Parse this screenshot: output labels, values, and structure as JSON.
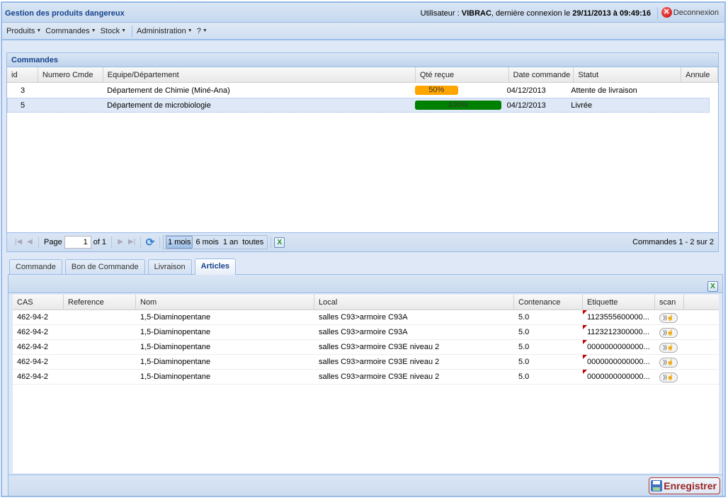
{
  "app": {
    "title": "Gestion des produits dangereux",
    "user_prefix": "Utilisateur : ",
    "user_name": "VIBRAC",
    "last_login_prefix": ", dernière connexion le ",
    "last_login": "29/11/2013 à 09:49:16",
    "logout_label": "Deconnexion"
  },
  "menu": [
    {
      "label": "Produits"
    },
    {
      "label": "Commandes"
    },
    {
      "label": "Stock"
    },
    {
      "label": "Administration"
    },
    {
      "label": "?"
    }
  ],
  "commandes": {
    "title": "Commandes",
    "columns": [
      "id",
      "Numero Cmde",
      "Equipe/Département",
      "Qté reçue",
      "Date commande",
      "Statut",
      "Annule"
    ],
    "rows": [
      {
        "id": "3",
        "numero": "",
        "equipe": "Département de Chimie (Miné-Ana)",
        "qte_label": "50%",
        "qte_fraction": 0.5,
        "qte_color": "#ffa500",
        "date": "04/12/2013",
        "statut": "Attente de livraison",
        "annule": "",
        "selected": false
      },
      {
        "id": "5",
        "numero": "",
        "equipe": "Département de microbiologie",
        "qte_label": "100%",
        "qte_fraction": 1.0,
        "qte_color": "#008000",
        "date": "04/12/2013",
        "statut": "Livrée",
        "annule": "",
        "selected": true
      }
    ],
    "pager": {
      "page_label": "Page",
      "page_value": "1",
      "of_label": "of 1",
      "ranges": [
        {
          "label": "1 mois",
          "active": true
        },
        {
          "label": "6 mois",
          "active": false
        },
        {
          "label": "1 an",
          "active": false
        },
        {
          "label": "toutes",
          "active": false
        }
      ],
      "info": "Commandes 1 - 2 sur 2"
    }
  },
  "tabs": [
    {
      "label": "Commande",
      "active": false
    },
    {
      "label": "Bon de Commande",
      "active": false
    },
    {
      "label": "Livraison",
      "active": false
    },
    {
      "label": "Articles",
      "active": true
    }
  ],
  "articles": {
    "columns": [
      "CAS",
      "Reference",
      "Nom",
      "Local",
      "Contenance",
      "Etiquette",
      "scan"
    ],
    "rows": [
      {
        "cas": "462-94-2",
        "reference": "",
        "nom": "1,5-Diaminopentane",
        "local": "salles C93>armoire C93A",
        "contenance": "5.0",
        "etiquette": "1123555600000..."
      },
      {
        "cas": "462-94-2",
        "reference": "",
        "nom": "1,5-Diaminopentane",
        "local": "salles C93>armoire C93A",
        "contenance": "5.0",
        "etiquette": "1123212300000..."
      },
      {
        "cas": "462-94-2",
        "reference": "",
        "nom": "1,5-Diaminopentane",
        "local": "salles C93>armoire C93E niveau 2",
        "contenance": "5.0",
        "etiquette": "0000000000000..."
      },
      {
        "cas": "462-94-2",
        "reference": "",
        "nom": "1,5-Diaminopentane",
        "local": "salles C93>armoire C93E niveau 2",
        "contenance": "5.0",
        "etiquette": "0000000000000..."
      },
      {
        "cas": "462-94-2",
        "reference": "",
        "nom": "1,5-Diaminopentane",
        "local": "salles C93>armoire C93E niveau 2",
        "contenance": "5.0",
        "etiquette": "0000000000000..."
      }
    ],
    "save_label": "Enregistrer"
  },
  "icons": {
    "logout": "close-circle-icon",
    "first": "first-page-icon",
    "prev": "prev-page-icon",
    "next": "next-page-icon",
    "last": "last-page-icon",
    "refresh": "refresh-icon",
    "excel": "excel-export-icon",
    "scan": "rfid-scan-icon",
    "save": "floppy-disk-icon"
  }
}
